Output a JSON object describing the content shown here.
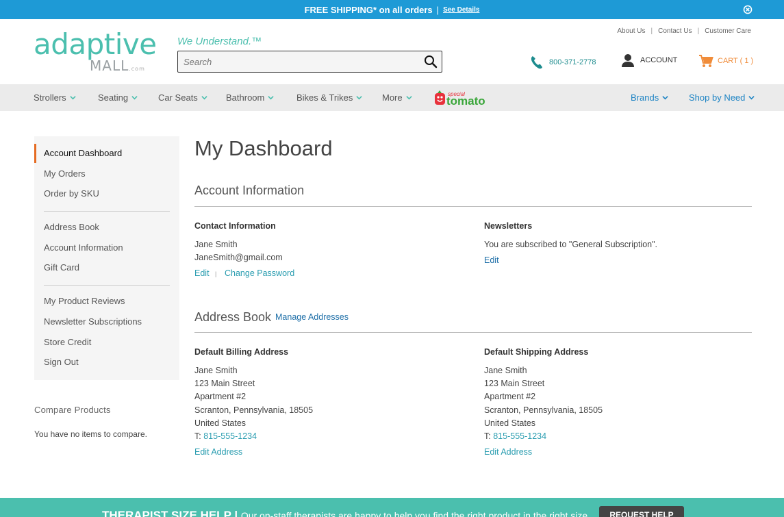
{
  "promo": {
    "text": "FREE SHIPPING* on all orders",
    "separator": "|",
    "link": "See Details"
  },
  "header": {
    "logo_main": "adaptive",
    "logo_sub": "MALL",
    "logo_dotcom": ".com",
    "tagline": "We Understand.™",
    "search_placeholder": "Search",
    "toplinks": [
      "About Us",
      "Contact Us",
      "Customer Care"
    ],
    "phone": "800-371-2778",
    "account": "ACCOUNT",
    "cart": "CART ( 1 )"
  },
  "nav": {
    "items": [
      "Strollers",
      "Seating",
      "Car Seats",
      "Bathroom",
      "Bikes & Trikes",
      "More"
    ],
    "right_items": [
      "Brands",
      "Shop by Need"
    ],
    "special_brand_top": "special",
    "special_brand": "tomato"
  },
  "sidebar": {
    "items": [
      "Account Dashboard",
      "My Orders",
      "Order by SKU",
      "Address Book",
      "Account Information",
      "Gift Card",
      "My Product Reviews",
      "Newsletter Subscriptions",
      "Store Credit",
      "Sign Out"
    ],
    "compare_title": "Compare Products",
    "compare_text": "You have no items to compare."
  },
  "main": {
    "title": "My Dashboard",
    "account_info": {
      "heading": "Account Information",
      "contact_title": "Contact Information",
      "name": "Jane Smith",
      "email": "JaneSmith@gmail.com",
      "edit": "Edit",
      "change_password": "Change Password",
      "newsletters_title": "Newsletters",
      "newsletters_text": "You are subscribed to \"General Subscription\".",
      "newsletters_edit": "Edit"
    },
    "address_book": {
      "heading": "Address Book",
      "manage": "Manage Addresses",
      "billing": {
        "title": "Default Billing Address",
        "lines": [
          "Jane Smith",
          "123 Main Street",
          "Apartment #2",
          "Scranton, Pennsylvania, 18505",
          "United States"
        ],
        "phone_prefix": "T:",
        "phone": "815-555-1234",
        "edit": "Edit Address"
      },
      "shipping": {
        "title": "Default Shipping Address",
        "lines": [
          "Jane Smith",
          "123 Main Street",
          "Apartment #2",
          "Scranton, Pennsylvania, 18505",
          "United States"
        ],
        "phone_prefix": "T:",
        "phone": "815-555-1234",
        "edit": "Edit Address"
      }
    }
  },
  "footer": {
    "heading": "THERAPIST SIZE HELP |",
    "text": "Our on-staff therapists are happy to help you find the right product in the right size.",
    "button": "REQUEST HELP"
  },
  "colors": {
    "brand_teal": "#4bbfae",
    "promo_blue": "#1e9ad6",
    "cart_orange": "#f08c3a",
    "active_bar": "#e56b22"
  }
}
